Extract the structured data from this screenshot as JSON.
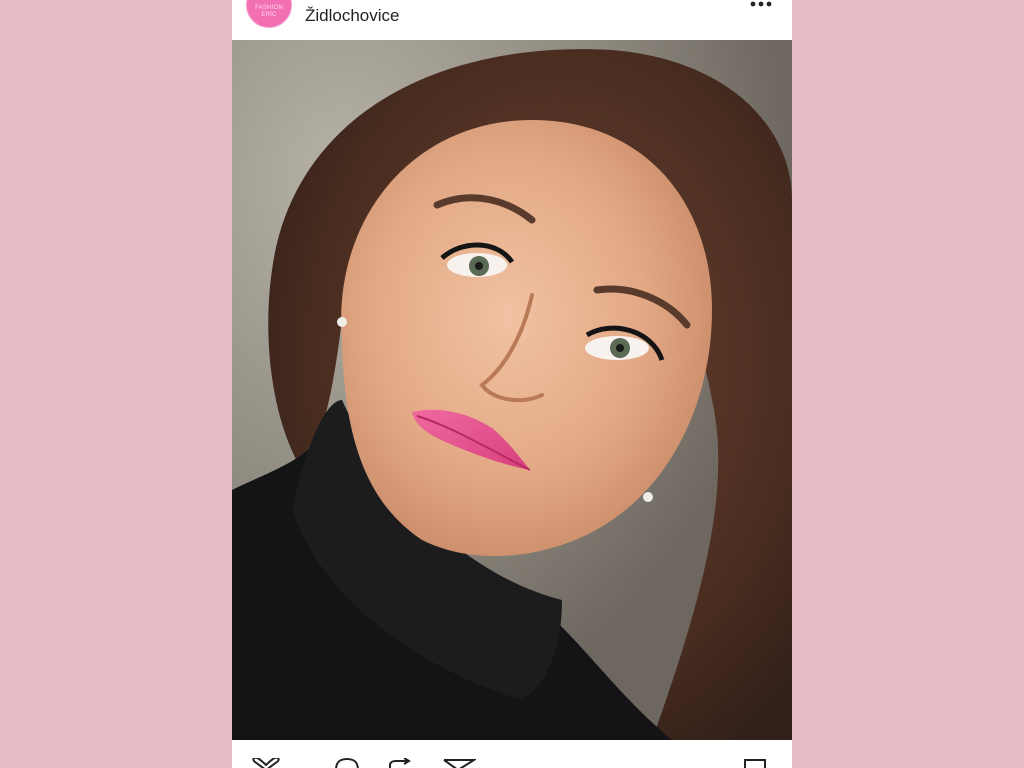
{
  "post": {
    "avatar_icon": "brand-logo-avatar",
    "avatar_text": "FASHION ERIC",
    "location": "Židlochovice",
    "more_icon": "more-options-icon",
    "photo_alt": "portrait photo",
    "actions": {
      "like_icon": "heart-icon",
      "like_count": "",
      "comment_icon": "comment-icon",
      "repost_icon": "repost-icon",
      "share_icon": "send-icon",
      "save_icon": "bookmark-icon"
    }
  },
  "colors": {
    "background": "#e7bcc5",
    "avatar": "#f36fb4",
    "text": "#222222"
  }
}
